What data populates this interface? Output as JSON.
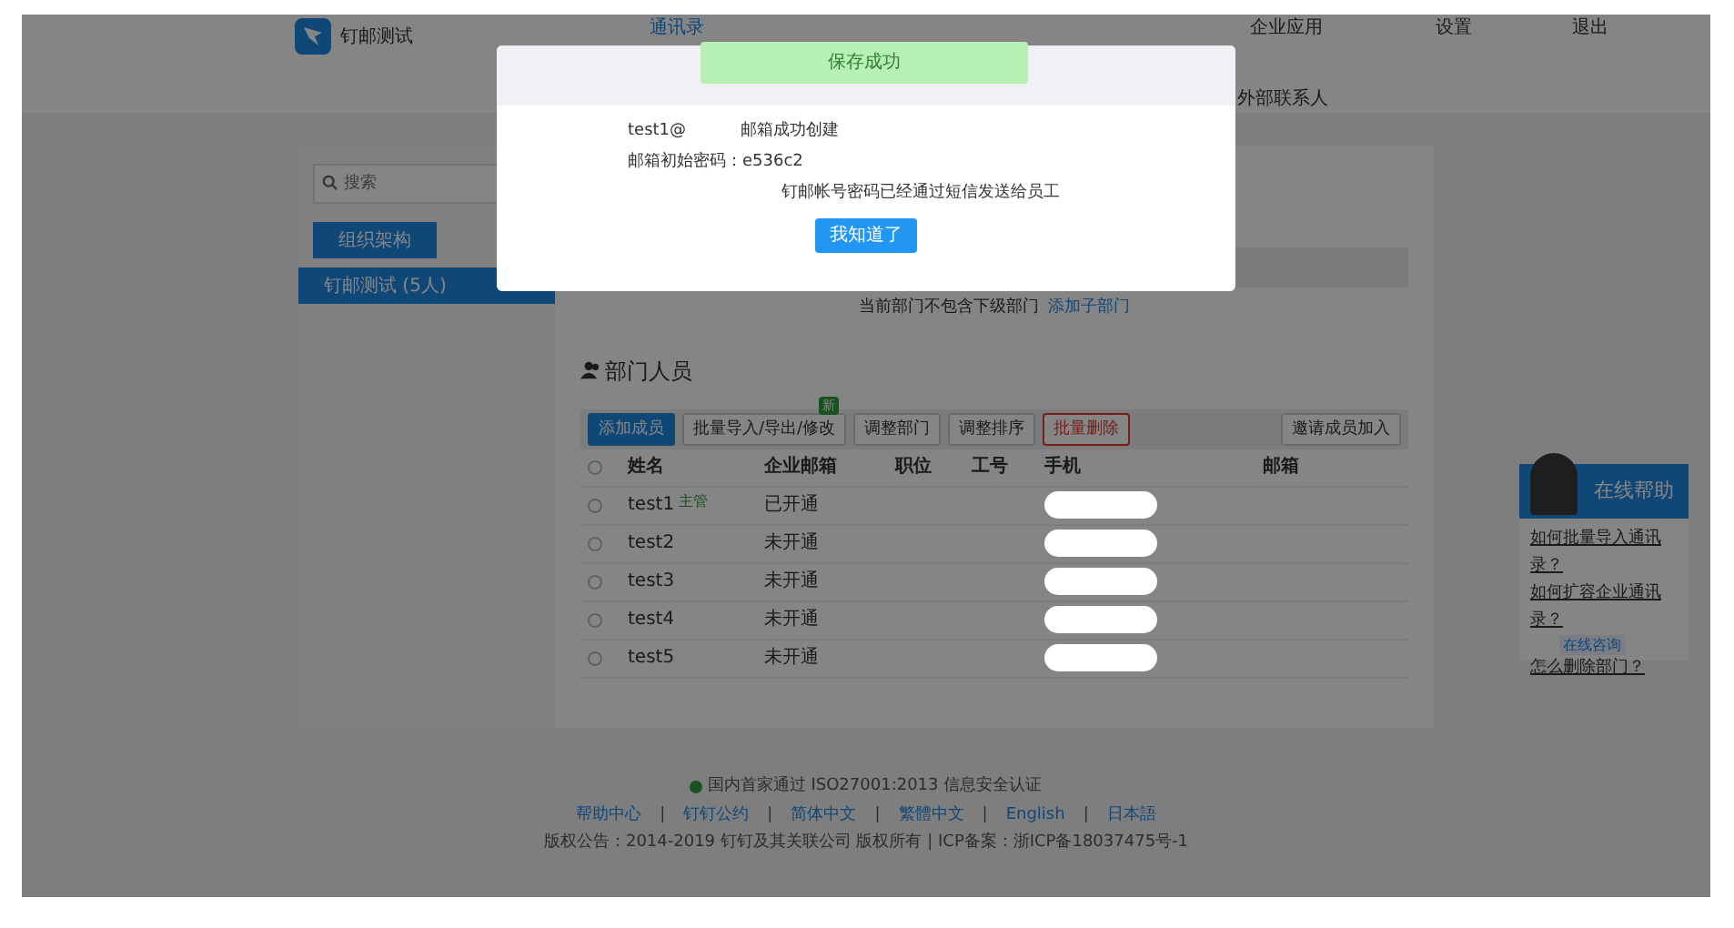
{
  "header": {
    "logo_text": "钉邮测试",
    "nav": [
      {
        "label": "通讯录",
        "selected": true
      },
      {
        "label": "企业应用",
        "selected": false
      },
      {
        "label": "设置",
        "selected": false
      },
      {
        "label": "退出",
        "selected": false
      }
    ],
    "subnav": [
      {
        "label": "外部联系人"
      }
    ]
  },
  "sidebar": {
    "search": {
      "placeholder": "搜索"
    },
    "tabs": [
      {
        "label": "组织架构",
        "selected": true
      }
    ],
    "items": [
      {
        "label": "钉邮测试 (5人)",
        "selected": true
      }
    ]
  },
  "department": {
    "notice": "当前部门不包含下级部门",
    "notice_link": "添加子部门"
  },
  "members": {
    "title": "部门人员",
    "toolbar": [
      {
        "label": "添加成员",
        "kind": "primary"
      },
      {
        "label": "批量导入/导出/修改",
        "kind": "default",
        "badge": "新"
      },
      {
        "label": "调整部门",
        "kind": "default"
      },
      {
        "label": "调整排序",
        "kind": "default"
      },
      {
        "label": "批量删除",
        "kind": "danger"
      }
    ],
    "invite_button": "邀请成员加入",
    "all_checked": false,
    "columns": [
      "姓名",
      "企业邮箱",
      "职位",
      "工号",
      "手机",
      "邮箱"
    ],
    "rows": [
      {
        "name": "test1",
        "tag": "主管",
        "mail_status": "已开通",
        "checked": false
      },
      {
        "name": "test2",
        "mail_status": "未开通",
        "checked": false
      },
      {
        "name": "test3",
        "mail_status": "未开通",
        "checked": false
      },
      {
        "name": "test4",
        "mail_status": "未开通",
        "checked": false
      },
      {
        "name": "test5",
        "mail_status": "未开通",
        "checked": false
      }
    ]
  },
  "footer": {
    "certification": "国内首家通过 ISO27001:2013 信息安全认证",
    "links": [
      "帮助中心",
      "钉钉公约",
      "简体中文",
      "繁體中文",
      "English",
      "日本語"
    ],
    "separator": "|",
    "copyright": "版权公告：2014-2019 钉钉及其关联公司 版权所有 | ICP备案：浙ICP备18037475号-1"
  },
  "help": {
    "title": "在线帮助",
    "links": [
      "如何批量导入通讯录？",
      "如何扩容企业通讯录？",
      "怎么删除部门？"
    ],
    "consult": "在线咨询"
  },
  "modal": {
    "toast": "保存成功",
    "account": "test1@",
    "account_status": "邮箱成功创建",
    "password": "邮箱初始密码：e536c2",
    "notice": "钉邮帐号密码已经通过短信发送给员工",
    "button": "我知道了"
  }
}
